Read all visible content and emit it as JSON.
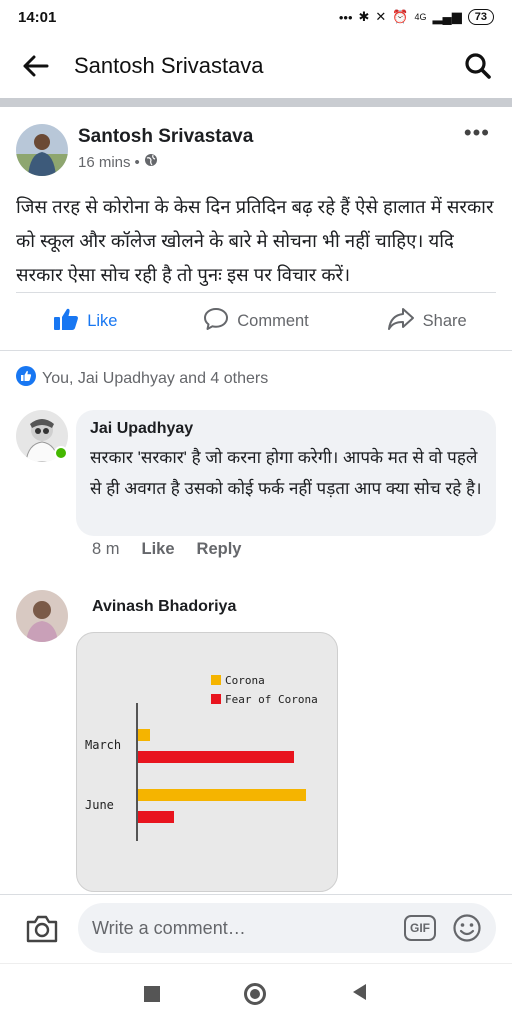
{
  "status_bar": {
    "time": "14:01",
    "icons": [
      "dots-icon",
      "bluetooth-icon",
      "mute-icon",
      "alarm-icon",
      "signal-icon"
    ],
    "network": "4G",
    "battery": "73"
  },
  "header": {
    "title": "Santosh Srivastava"
  },
  "post": {
    "author": "Santosh Srivastava",
    "time": "16 mins",
    "dot": "•",
    "text": "जिस तरह से कोरोना के केस दिन प्रतिदिन बढ़ रहे हैं ऐसे हालात में सरकार को स्कूल और कॉलेज खोलने के बारे मे सोचना भी नहीं चाहिए। यदि सरकार ऐसा सोच रही है तो पुनः इस पर विचार करें।",
    "actions": {
      "like": "Like",
      "comment": "Comment",
      "share": "Share"
    },
    "reactions_text": "You, Jai Upadhyay and 4 others"
  },
  "comments": [
    {
      "author": "Jai Upadhyay",
      "text": "सरकार 'सरकार' है जो करना होगा करेगी। आपके मत से वो पहले से ही अवगत है उसको कोई फर्क नहीं पड़ता आप क्या सोच रहे है।",
      "time": "8 m",
      "like": "Like",
      "reply": "Reply"
    },
    {
      "author": "Avinash Bhadoriya"
    }
  ],
  "chart_data": {
    "type": "bar",
    "orientation": "horizontal",
    "categories": [
      "March",
      "June"
    ],
    "series": [
      {
        "name": "Corona",
        "color": "#f5b400",
        "values": [
          1,
          14
        ]
      },
      {
        "name": "Fear of Corona",
        "color": "#e8141e",
        "values": [
          13,
          3
        ]
      }
    ],
    "legend_position": "top-right",
    "grid": false
  },
  "composer": {
    "placeholder": "Write a comment…",
    "gif": "GIF"
  },
  "colors": {
    "facebook_blue": "#1877f2",
    "secondary_text": "#65676b",
    "bubble_bg": "#f0f2f5"
  }
}
